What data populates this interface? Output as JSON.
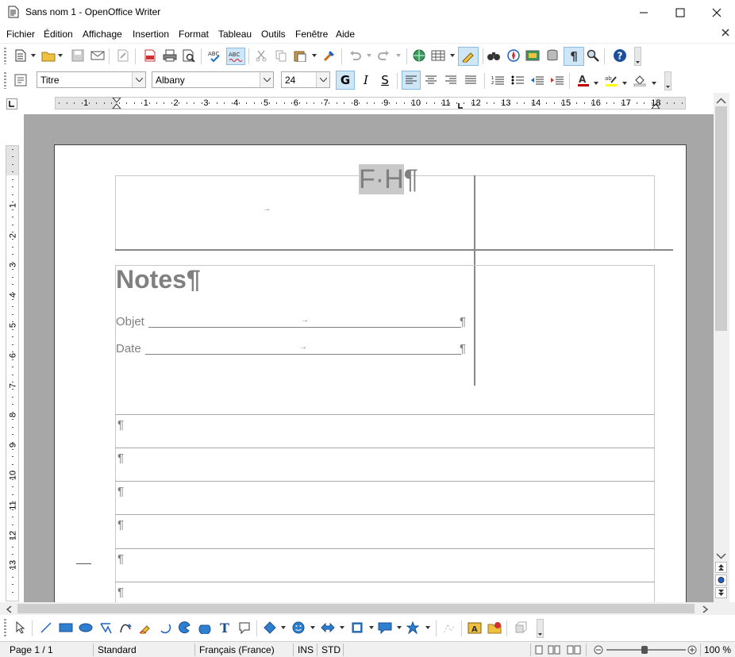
{
  "window": {
    "title": "Sans nom 1 - OpenOffice Writer"
  },
  "menu": [
    "Fichier",
    "Édition",
    "Affichage",
    "Insertion",
    "Format",
    "Tableau",
    "Outils",
    "Fenêtre",
    "Aide"
  ],
  "formatting": {
    "style": "Titre",
    "font": "Albany",
    "size": "24",
    "bold": "G",
    "italic": "I",
    "underline": "S"
  },
  "ruler": {
    "h_numbers": [
      "1",
      "1",
      "2",
      "3",
      "4",
      "5",
      "6",
      "7",
      "8",
      "9",
      "10",
      "11",
      "12",
      "13",
      "14",
      "15",
      "16",
      "17",
      "18"
    ],
    "v_numbers": [
      "1",
      "2",
      "3",
      "4",
      "5",
      "6",
      "7",
      "8",
      "9",
      "10",
      "11",
      "12",
      "13"
    ]
  },
  "document": {
    "header_initials": "F·H",
    "pilcrow": "¶",
    "tab_arrow": "→",
    "notes_title": "Notes¶",
    "fields": [
      {
        "label": "Objet"
      },
      {
        "label": "Date"
      }
    ],
    "lined_rows": 6
  },
  "status": {
    "page": "Page 1 / 1",
    "style": "Standard",
    "language": "Français (France)",
    "mode": "INS",
    "selection": "STD",
    "zoom": "100 %"
  },
  "colors": {
    "accent": "#cfe6f7",
    "workspace": "#a7a7a7",
    "doc_text": "#808080"
  }
}
